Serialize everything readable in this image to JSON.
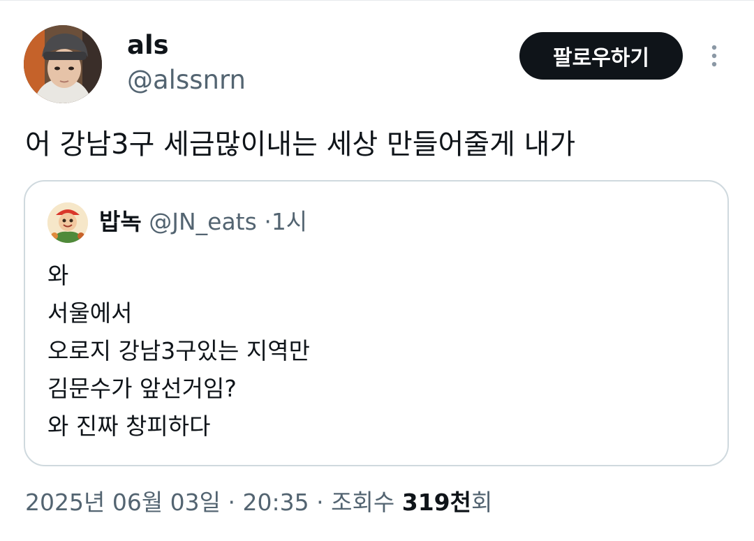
{
  "author": {
    "name": "als",
    "handle": "@alssnrn",
    "avatar_icon": "profile-photo-person-in-knit-beanie"
  },
  "follow_button": {
    "label": "팔로우하기",
    "background": "#0f1419",
    "text_color": "#ffffff"
  },
  "more_icon": "more-vertical-icon",
  "tweet_text": "어 강남3구 세금많이내는 세상 만들어줄게 내가",
  "quoted_tweet": {
    "name": "밥녹",
    "handle": "@JN_eats",
    "separator": "·",
    "time": "1시",
    "avatar_icon": "cartoon-mascot-avatar",
    "lines": [
      "와",
      "서울에서",
      "오로지 강남3구있는 지역만",
      "김문수가 앞선거임?",
      "와 진짜 창피하다"
    ]
  },
  "meta": {
    "date": "2025년 06월 03일",
    "separator": "·",
    "time": "20:35",
    "views_label": "조회수",
    "views_count": "319천",
    "views_suffix": "회"
  },
  "colors": {
    "text_primary": "#0f1419",
    "text_secondary": "#536471",
    "border": "#cfd9de"
  }
}
